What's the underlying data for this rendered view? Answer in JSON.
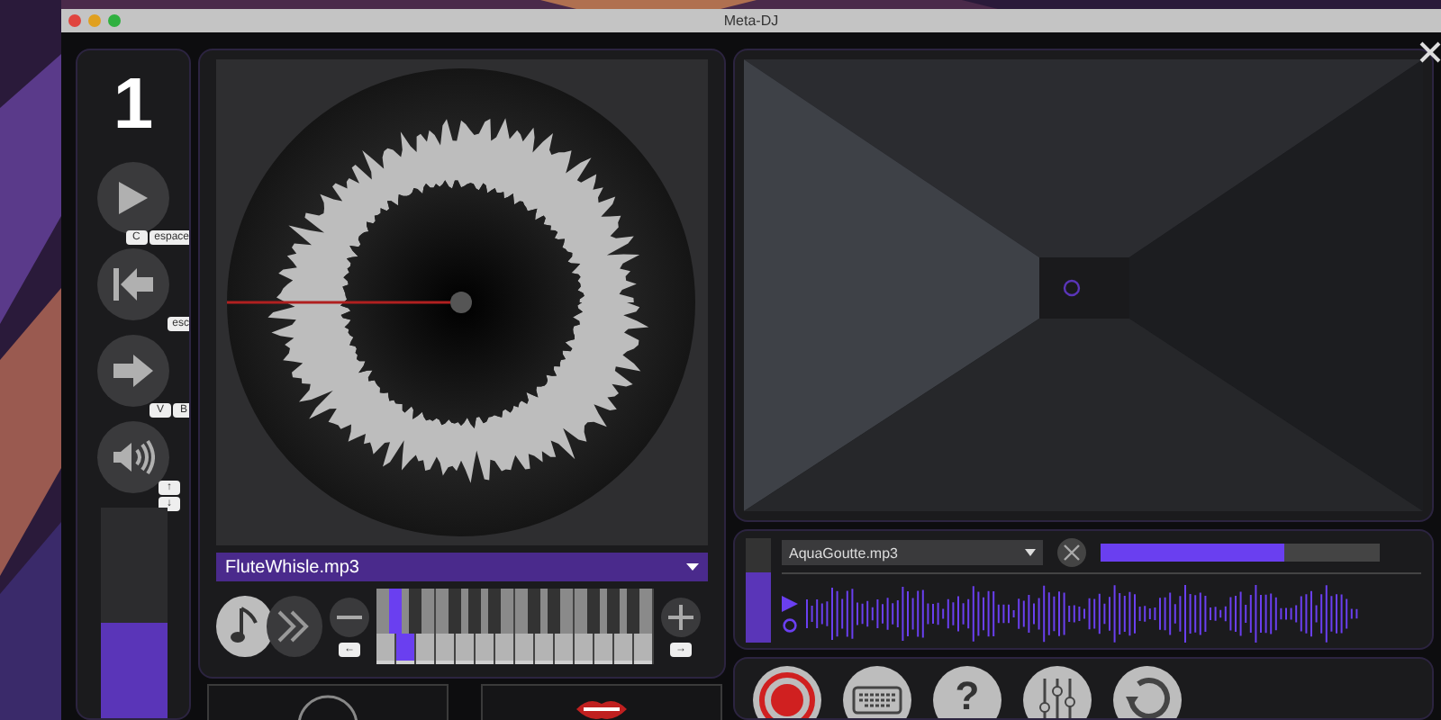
{
  "window": {
    "title": "Meta-DJ"
  },
  "deck": {
    "number": "1"
  },
  "transport": [
    {
      "kind": "play",
      "keys": [
        "C",
        "espace"
      ]
    },
    {
      "kind": "rewind",
      "keys": [
        "esc"
      ]
    },
    {
      "kind": "forward",
      "keys": [
        "V",
        "B"
      ]
    },
    {
      "kind": "volume",
      "keys": [
        "↑",
        "↓"
      ]
    }
  ],
  "volume_meter": {
    "level": 0.45
  },
  "player": {
    "file": "FluteWhisle.mp3"
  },
  "modes": [
    {
      "kind": "note",
      "selected": true
    },
    {
      "kind": "skip",
      "selected": false
    }
  ],
  "octave": {
    "down_key": "←",
    "up_key": "→"
  },
  "white_keys": [
    {
      "selected": false
    },
    {
      "selected": true
    },
    {
      "selected": false
    },
    {
      "selected": false
    },
    {
      "selected": false
    },
    {
      "selected": false
    },
    {
      "selected": false
    },
    {
      "selected": false
    },
    {
      "selected": false
    },
    {
      "selected": false
    },
    {
      "selected": false
    },
    {
      "selected": false
    },
    {
      "selected": false
    },
    {
      "selected": false
    }
  ],
  "black_keys": [
    {
      "selected": true
    },
    {
      "selected": false
    },
    {
      "selected": false
    },
    {
      "selected": false
    },
    {
      "selected": false
    },
    {
      "selected": false
    },
    {
      "selected": false
    },
    {
      "selected": false
    },
    {
      "selected": false
    },
    {
      "selected": false
    }
  ],
  "sampler": {
    "file": "AquaGoutte.mp3",
    "progress": {
      "level": 0.66
    },
    "meter": {
      "level": 0.68
    }
  },
  "toolbar": [
    {
      "kind": "record"
    },
    {
      "kind": "keyboard"
    },
    {
      "kind": "help",
      "label": "?"
    },
    {
      "kind": "mixer"
    },
    {
      "kind": "reset"
    }
  ]
}
